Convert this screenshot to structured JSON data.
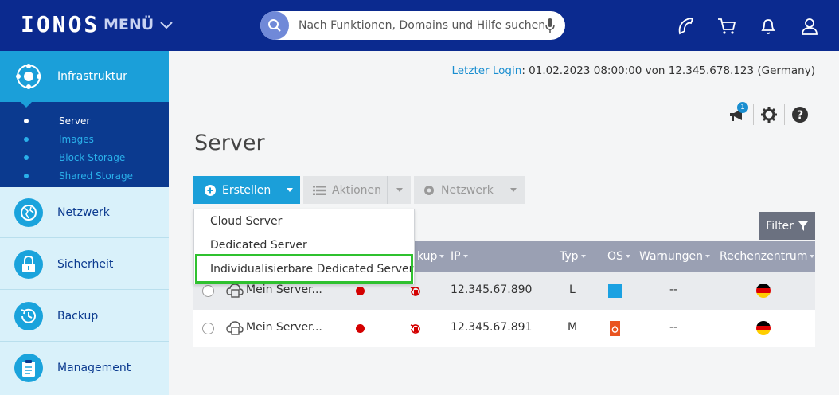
{
  "header": {
    "logo": "IONOS",
    "menu_label": "MENÜ",
    "search_placeholder": "Nach Funktionen, Domains und Hilfe suchen",
    "icons": [
      "phone-icon",
      "cart-icon",
      "bell-icon",
      "user-icon"
    ]
  },
  "sidebar": {
    "items": [
      {
        "label": "Infrastruktur",
        "icon": "infrastructure-icon",
        "active": true
      },
      {
        "label": "Netzwerk",
        "icon": "network-globe-icon"
      },
      {
        "label": "Sicherheit",
        "icon": "lock-icon"
      },
      {
        "label": "Backup",
        "icon": "backup-clock-icon"
      },
      {
        "label": "Management",
        "icon": "clipboard-icon"
      }
    ],
    "subitems": [
      {
        "label": "Server",
        "current": true
      },
      {
        "label": "Images"
      },
      {
        "label": "Block Storage"
      },
      {
        "label": "Shared Storage"
      }
    ]
  },
  "last_login": {
    "label": "Letzter Login",
    "value": ": 01.02.2023 08:00:00 von 12.345.678.123 (Germany)"
  },
  "utility": {
    "notification_count": "1",
    "icons": [
      "megaphone-icon",
      "gear-icon",
      "help-icon"
    ]
  },
  "page_title": "Server",
  "toolbar": {
    "create_label": "Erstellen",
    "actions_label": "Aktionen",
    "network_label": "Netzwerk",
    "filter_label": "Filter"
  },
  "dropdown": {
    "items": [
      "Cloud Server",
      "Dedicated Server",
      "Individualisierbare Dedicated Server"
    ]
  },
  "table": {
    "headers": [
      "kup",
      "IP",
      "Typ",
      "OS",
      "Warnungen",
      "Rechenzentrum"
    ],
    "rows": [
      {
        "name": "Mein Server...",
        "ip": "12.345.67.890",
        "type": "L",
        "os": "windows-logo-icon",
        "warnings": "--",
        "datacenter": "germany-flag-icon"
      },
      {
        "name": "Mein Server...",
        "ip": "12.345.67.891",
        "type": "M",
        "os": "ubuntu-logo-icon",
        "warnings": "--",
        "datacenter": "germany-flag-icon"
      }
    ]
  },
  "colors": {
    "header_bg": "#0b2a8f",
    "accent": "#1b9fd9",
    "sidebar_bg": "#d9f1fa",
    "highlight": "#2fc12f",
    "status_red": "#d40000"
  }
}
